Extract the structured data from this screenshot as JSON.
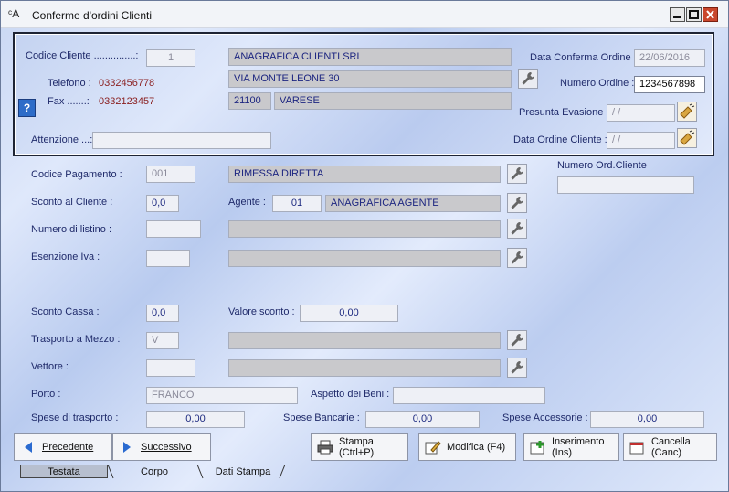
{
  "window": {
    "title": "Conferme d'ordini Clienti",
    "icon_glyph": "ᶜA"
  },
  "header": {
    "codice_cliente_label": "Codice Cliente ...............:",
    "codice_cliente_value": "1",
    "ragione_sociale": "ANAGRAFICA CLIENTI SRL",
    "indirizzo": "VIA MONTE LEONE 30",
    "cap": "21100",
    "citta": "VARESE",
    "telefono_label": "Telefono :",
    "telefono_value": "0332456778",
    "fax_label": "Fax .......:",
    "fax_value": "0332123457",
    "attenzione_label": "Attenzione ...:",
    "attenzione_value": "",
    "data_conferma_label": "Data Conferma Ordine :",
    "data_conferma_value": "22/06/2016",
    "numero_ordine_label": "Numero Ordine :",
    "numero_ordine_value": "1234567898",
    "presunta_evasione_label": "Presunta Evasione :",
    "presunta_evasione_value": "/ /",
    "data_ordine_cliente_label": "Data Ordine Cliente :",
    "data_ordine_cliente_value": "/ /"
  },
  "body": {
    "codice_pagamento_label": "Codice Pagamento :",
    "codice_pagamento_value": "001",
    "codice_pagamento_desc": "RIMESSA DIRETTA",
    "numero_ord_cliente_label": "Numero Ord.Cliente",
    "numero_ord_cliente_value": "",
    "sconto_cliente_label": "Sconto al Cliente :",
    "sconto_cliente_value": "0,0",
    "agente_label": "Agente :",
    "agente_value": "01",
    "agente_desc": "ANAGRAFICA AGENTE",
    "numero_listino_label": "Numero di listino :",
    "numero_listino_value": "",
    "numero_listino_desc": "",
    "esenzione_iva_label": "Esenzione Iva :",
    "esenzione_iva_value": "",
    "esenzione_iva_desc": "",
    "sconto_cassa_label": "Sconto Cassa :",
    "sconto_cassa_value": "0,0",
    "valore_sconto_label": "Valore sconto :",
    "valore_sconto_value": "0,00",
    "trasporto_label": "Trasporto a Mezzo :",
    "trasporto_value": "V",
    "trasporto_desc": "",
    "vettore_label": "Vettore :",
    "vettore_value": "",
    "vettore_desc": "",
    "porto_label": "Porto :",
    "porto_value": "FRANCO",
    "aspetto_label": "Aspetto dei Beni :",
    "aspetto_value": "",
    "spese_trasporto_label": "Spese di trasporto :",
    "spese_trasporto_value": "0,00",
    "spese_bancarie_label": "Spese Bancarie :",
    "spese_bancarie_value": "0,00",
    "spese_accessorie_label": "Spese Accessorie :",
    "spese_accessorie_value": "0,00"
  },
  "buttons": {
    "precedente": "Precedente",
    "successivo": "Successivo",
    "stampa": "Stampa (Ctrl+P)",
    "modifica": "Modifica (F4)",
    "inserimento": "Inserimento (Ins)",
    "cancella": "Cancella (Canc)"
  },
  "tabs": [
    "Testata",
    "Corpo",
    "Dati Stampa"
  ],
  "colors": {
    "label": "#1f2a6a",
    "phone": "#8a1f1f",
    "close": "#c9462c"
  }
}
